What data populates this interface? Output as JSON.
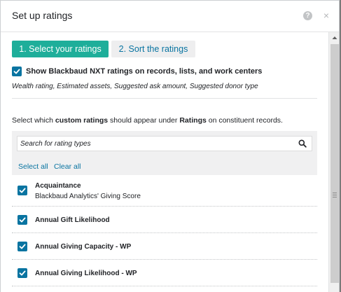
{
  "header": {
    "title": "Set up ratings",
    "help_glyph": "?",
    "close_glyph": "×"
  },
  "steps": [
    {
      "label": "1. Select your ratings",
      "state": "active"
    },
    {
      "label": "2. Sort the ratings",
      "state": "inactive"
    }
  ],
  "show_nxt": {
    "checked": true,
    "label": "Show Blackbaud NXT ratings on records, lists, and work centers",
    "description": "Wealth rating, Estimated assets, Suggested ask amount, Suggested donor type"
  },
  "instruction": {
    "part1": "Select which ",
    "bold1": "custom ratings",
    "part2": " should appear under ",
    "bold2": "Ratings",
    "part3": " on constituent records."
  },
  "search": {
    "placeholder": "Search for rating types",
    "value": ""
  },
  "links": {
    "select_all": "Select all",
    "clear_all": "Clear all"
  },
  "ratings": [
    {
      "name": "Acquaintance",
      "subtitle": "Blackbaud Analytics' Giving Score",
      "checked": true
    },
    {
      "name": "Annual Gift Likelihood",
      "subtitle": "",
      "checked": true
    },
    {
      "name": "Annual Giving Capacity - WP",
      "subtitle": "",
      "checked": true
    },
    {
      "name": "Annual Giving Likelihood - WP",
      "subtitle": "",
      "checked": true
    }
  ],
  "colors": {
    "accent_teal": "#1eae9a",
    "link_blue": "#0974a1",
    "checkbox_blue": "#0974a1"
  },
  "icons": {
    "help": "question-circle-icon",
    "close": "close-icon",
    "search": "search-icon",
    "check": "check-icon"
  }
}
